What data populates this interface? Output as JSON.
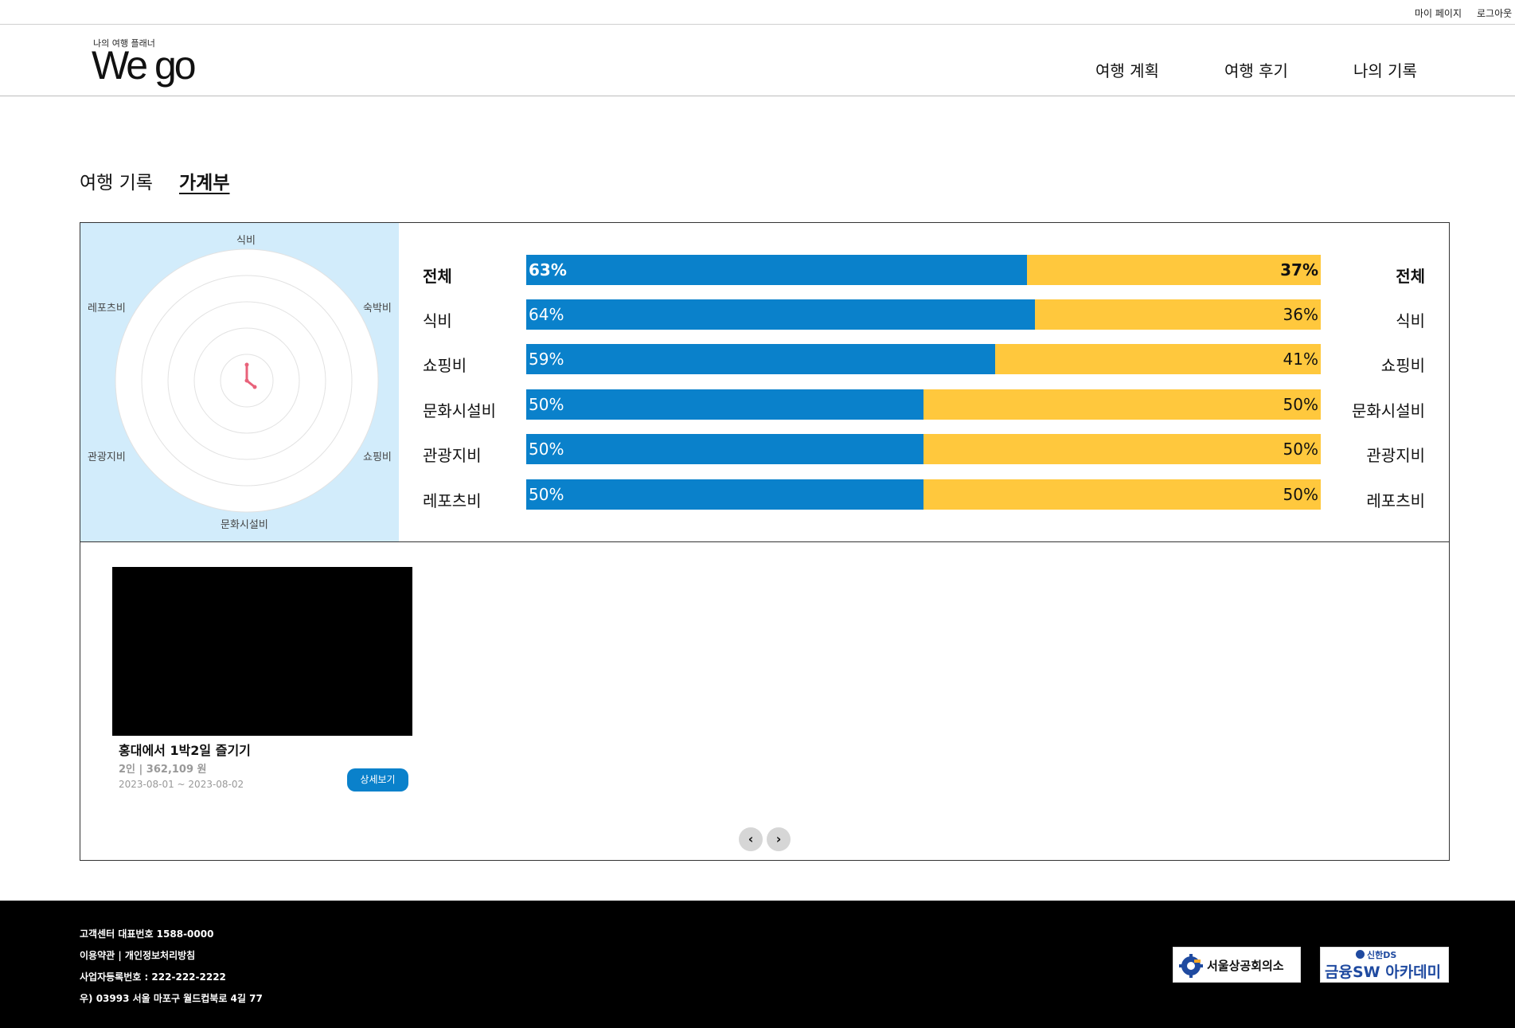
{
  "topbar": {
    "mypage": "마이 페이지",
    "logout": "로그아웃"
  },
  "header": {
    "logo_sub": "나의 여행 플래너",
    "logo_main": "We go",
    "nav": [
      "여행 계획",
      "여행 후기",
      "나의 기록"
    ]
  },
  "tabs": [
    "여행 기록",
    "가계부"
  ],
  "radar": {
    "labels": [
      "식비",
      "숙박비",
      "쇼핑비",
      "문화시설비",
      "관광지비",
      "레포츠비"
    ],
    "line_color": "#e8627a"
  },
  "comparison": [
    {
      "label": "전체",
      "left_pct": "63%",
      "right_pct": "37%",
      "value": 63
    },
    {
      "label": "식비",
      "left_pct": "64%",
      "right_pct": "36%",
      "value": 64
    },
    {
      "label": "쇼핑비",
      "left_pct": "59%",
      "right_pct": "41%",
      "value": 59
    },
    {
      "label": "문화시설비",
      "left_pct": "50%",
      "right_pct": "50%",
      "value": 50
    },
    {
      "label": "관광지비",
      "left_pct": "50%",
      "right_pct": "50%",
      "value": 50
    },
    {
      "label": "레포츠비",
      "left_pct": "50%",
      "right_pct": "50%",
      "value": 50
    }
  ],
  "colors": {
    "blue": "#0a81cb",
    "yellow": "#ffc83d",
    "radar_bg": "#d2ecfb"
  },
  "trip_card": {
    "title": "홍대에서 1박2일 즐기기",
    "meta": "2인 | 362,109 원",
    "date": "2023-08-01 ~ 2023-08-02",
    "button": "상세보기"
  },
  "pager": {
    "prev": "‹",
    "next": "›"
  },
  "footer": {
    "lines": [
      "고객센터 대표번호 1588-0000",
      "이용약관 | 개인정보처리방침",
      "사업자등록번호 : 222-222-2222",
      "우) 03993 서울 마포구 월드컵북로 4길 77"
    ],
    "partner1": "서울상공회의소",
    "partner2_top": "신한DS",
    "partner2_main": "금융SW 아카데미"
  }
}
